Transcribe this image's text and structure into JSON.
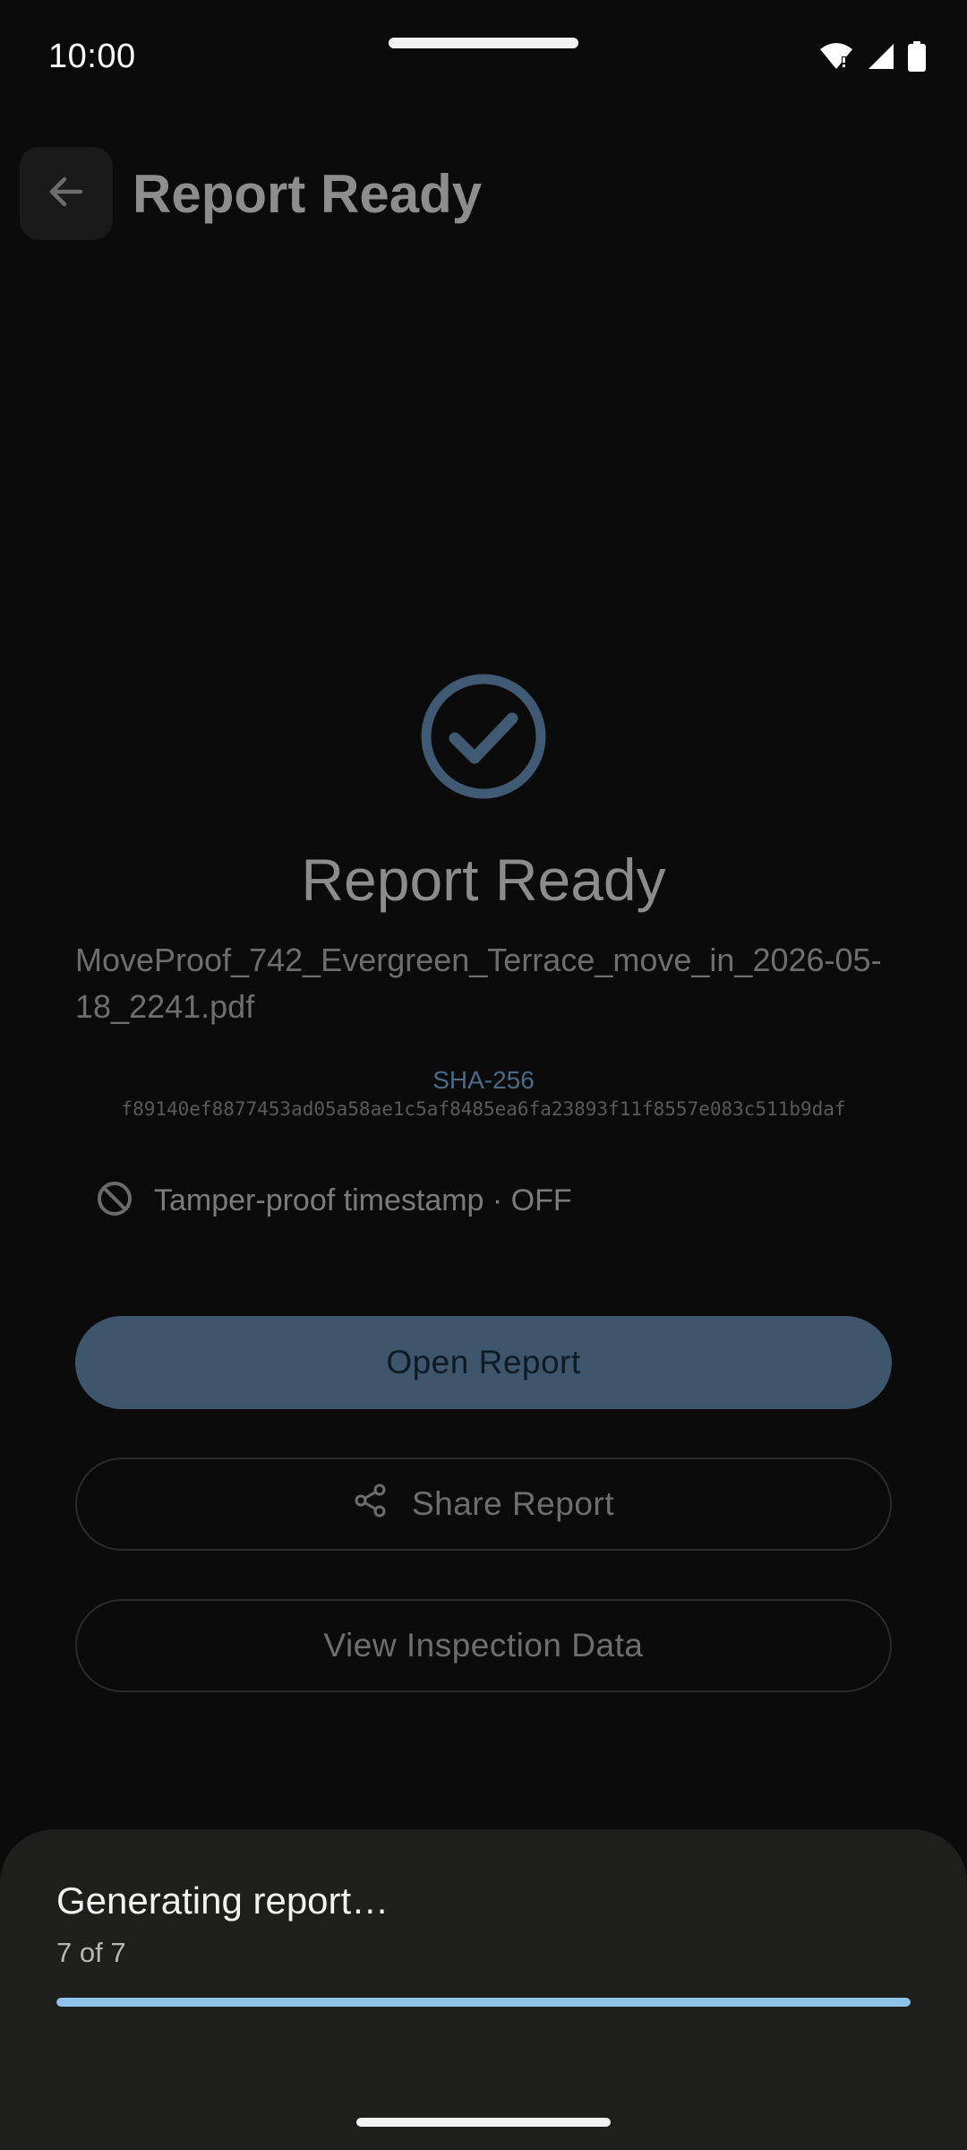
{
  "status_bar": {
    "time": "10:00",
    "icons": [
      "wifi-icon",
      "signal-icon",
      "battery-icon"
    ]
  },
  "app_bar": {
    "title": "Report Ready",
    "back_icon": "arrow-back-icon"
  },
  "main": {
    "title": "Report Ready",
    "filename": "MoveProof_742_Evergreen_Terrace_move_in_2026-05-18_2241.pdf",
    "hash_label": "SHA-256",
    "hash_value": "f89140ef8877453ad05a58ae1c5af8485ea6fa23893f11f8557e083c511b9daf",
    "tamper_text": "Tamper-proof timestamp · OFF",
    "buttons": {
      "open": "Open Report",
      "share": "Share Report",
      "view": "View Inspection Data"
    }
  },
  "sheet": {
    "title": "Generating report…",
    "progress_text": "7 of 7",
    "progress": 1.0
  },
  "colors": {
    "accent": "#8ec3ea",
    "primary_button": "#3d566b",
    "sheet_bg": "#1e1e1c"
  }
}
